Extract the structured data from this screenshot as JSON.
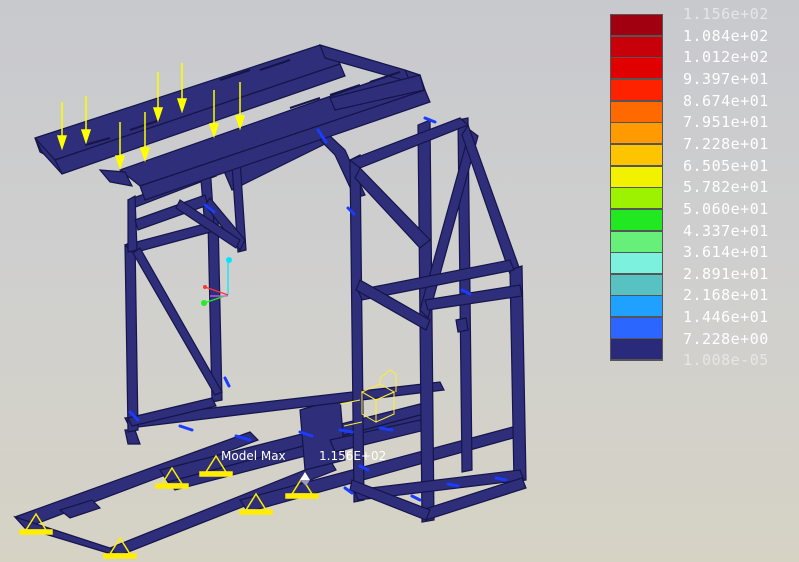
{
  "legend": {
    "entries": [
      {
        "label": "1.156e+02",
        "color": "#a10010"
      },
      {
        "label": "1.084e+02",
        "color": "#c8000a"
      },
      {
        "label": "1.012e+02",
        "color": "#e00000"
      },
      {
        "label": "9.397e+01",
        "color": "#ff2200"
      },
      {
        "label": "8.674e+01",
        "color": "#ff6a00"
      },
      {
        "label": "7.951e+01",
        "color": "#ff9a00"
      },
      {
        "label": "7.228e+01",
        "color": "#ffc400"
      },
      {
        "label": "6.505e+01",
        "color": "#f2f200"
      },
      {
        "label": "5.782e+01",
        "color": "#9cf200"
      },
      {
        "label": "5.060e+01",
        "color": "#22e822"
      },
      {
        "label": "4.337e+01",
        "color": "#66f07a"
      },
      {
        "label": "3.614e+01",
        "color": "#7cf2de"
      },
      {
        "label": "2.891e+01",
        "color": "#58c2c2"
      },
      {
        "label": "2.168e+01",
        "color": "#20a0ff"
      },
      {
        "label": "1.446e+01",
        "color": "#2a66ff"
      },
      {
        "label": "7.228e+00",
        "color": "#0010ff"
      },
      {
        "label": "1.008e-05",
        "color": "#2a2a7a"
      }
    ]
  },
  "annotation": {
    "model_max_label": "Model Max",
    "model_max_value": "1.156E+02"
  },
  "colors": {
    "frame": "#2e2e7a",
    "frame_edge": "#15154a",
    "frame_highlight": "#1a3cff",
    "load_arrow": "#ffff00",
    "support": "#ffee00"
  }
}
